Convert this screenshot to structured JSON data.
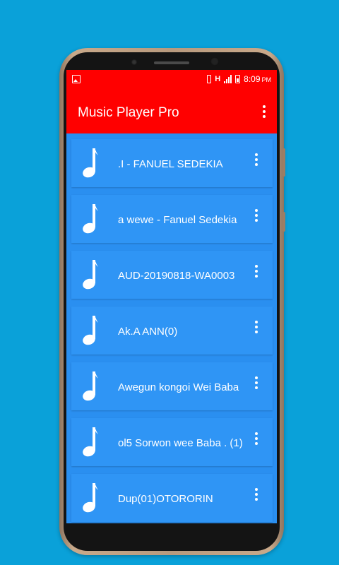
{
  "status_bar": {
    "network": "H",
    "time": "8:09",
    "ampm": "PM"
  },
  "app_bar": {
    "title": "Music Player Pro"
  },
  "songs": [
    {
      "title": "...I - FANUEL SEDEKIA",
      "visible_text": ".I  - FANUEL SEDEKIA"
    },
    {
      "title": "...a wewe - Fanuel Sedekia",
      "visible_text": "a wewe - Fanuel Sedekia"
    },
    {
      "title": "AUD-20190818-WA0003",
      "visible_text": "AUD-20190818-WA0003"
    },
    {
      "title": "Ak.A ANN(0)",
      "visible_text": "Ak.A ANN(0)"
    },
    {
      "title": "Awegun kongoi Wei Baba",
      "visible_text": "Awegun kongoi Wei Baba"
    },
    {
      "title": "...ol5 Sorwon wee Baba . (1)",
      "visible_text": "ol5 Sorwon wee Baba . (1)"
    },
    {
      "title": "Dup(01)OTORORIN",
      "visible_text": "Dup(01)OTORORIN"
    }
  ],
  "colors": {
    "background": "#0aa1d9",
    "app_bar": "#ff0000",
    "list_background": "#2a8ff0",
    "card": "#2f95f5",
    "text": "#ffffff"
  },
  "icons": {
    "song_icon": "music-note-icon",
    "menu_icon": "more-vert-icon"
  }
}
